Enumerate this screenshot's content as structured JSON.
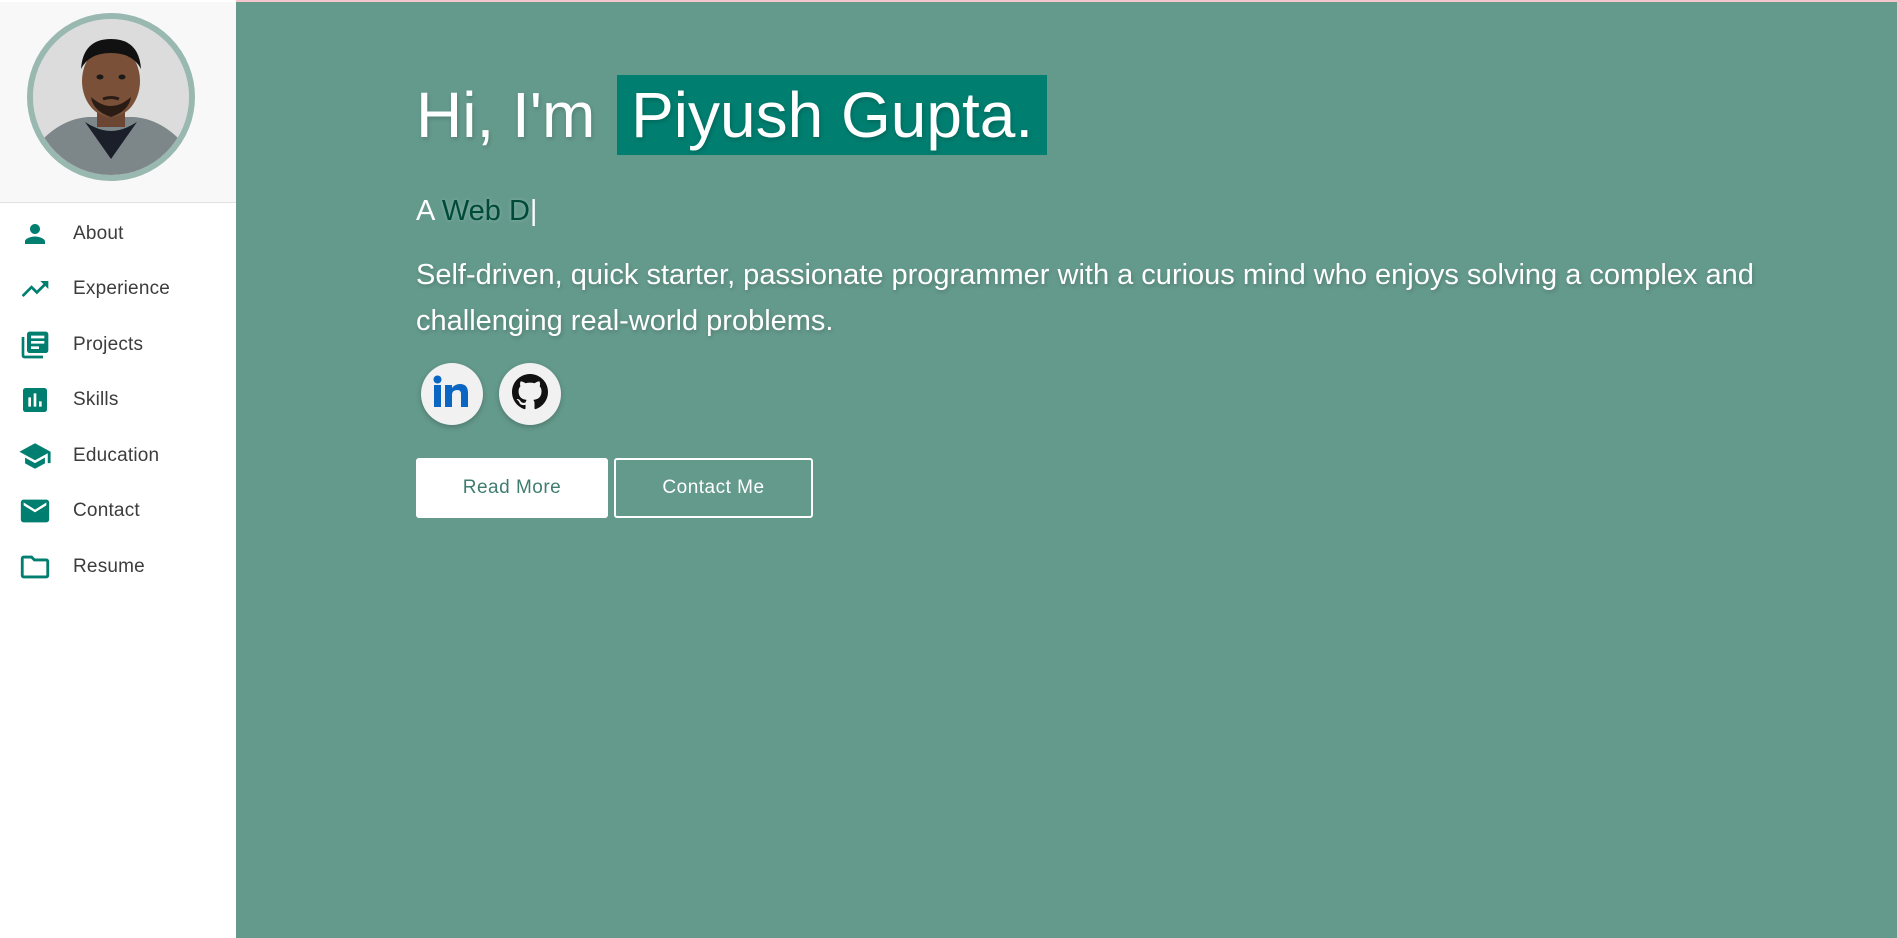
{
  "colors": {
    "accent": "#007e6f",
    "background": "#649a8c",
    "sidebar": "#ffffff",
    "nav_icon": "#007e6f"
  },
  "sidebar": {
    "items": [
      {
        "label": "About",
        "icon": "person-icon"
      },
      {
        "label": "Experience",
        "icon": "trending-up-icon"
      },
      {
        "label": "Projects",
        "icon": "library-books-icon"
      },
      {
        "label": "Skills",
        "icon": "bar-chart-icon"
      },
      {
        "label": "Education",
        "icon": "graduation-cap-icon"
      },
      {
        "label": "Contact",
        "icon": "mail-icon"
      },
      {
        "label": "Resume",
        "icon": "folder-icon"
      }
    ]
  },
  "hero": {
    "greeting": "Hi, I'm",
    "name": "Piyush Gupta.",
    "typing_prefix": "A",
    "typing_text": "Web D",
    "typing_cursor": "|",
    "bio": "Self-driven, quick starter, passionate programmer with a curious mind who enjoys solving a complex and challenging real-world problems."
  },
  "social": [
    {
      "icon": "linkedin-icon"
    },
    {
      "icon": "github-icon"
    }
  ],
  "buttons": {
    "read_more": "Read More",
    "contact_me": "Contact Me"
  }
}
